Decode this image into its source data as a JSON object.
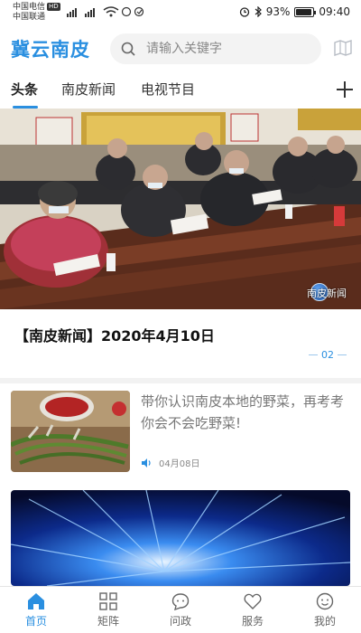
{
  "status_bar": {
    "carrier_1": "中国电信",
    "carrier_1_badge": "HD",
    "carrier_2": "中国联通",
    "battery": "93%",
    "battery_level": 0.93,
    "time": "09:40"
  },
  "header": {
    "app_title": "冀云南皮",
    "search_placeholder": "请输入关键字",
    "accent_color": "#2a8fe0"
  },
  "tabs": [
    {
      "label": "头条",
      "active": true
    },
    {
      "label": "南皮新闻",
      "active": false
    },
    {
      "label": "电视节目",
      "active": false
    }
  ],
  "hero": {
    "watermark": "南皮新闻",
    "title": "【南皮新闻】2020年4月10日",
    "page": "02"
  },
  "news_item": {
    "title": "带你认识南皮本地的野菜，再考考你会不会吃野菜!",
    "date": "04月08日"
  },
  "bottom_nav": [
    {
      "label": "首页",
      "icon": "home-icon",
      "active": true
    },
    {
      "label": "矩阵",
      "icon": "grid-icon",
      "active": false
    },
    {
      "label": "问政",
      "icon": "chat-icon",
      "active": false
    },
    {
      "label": "服务",
      "icon": "heart-icon",
      "active": false
    },
    {
      "label": "我的",
      "icon": "user-icon",
      "active": false
    }
  ]
}
